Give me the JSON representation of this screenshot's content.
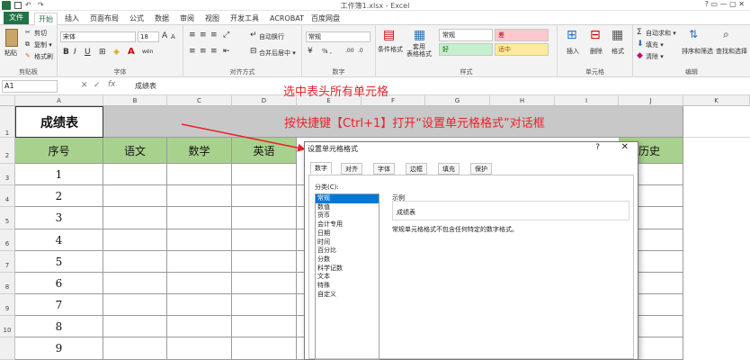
{
  "window": {
    "title": "工作簿1.xlsx - Excel",
    "controls": "?  ▭  —  ▢  ✕"
  },
  "tabs": [
    "文件",
    "开始",
    "插入",
    "页面布局",
    "公式",
    "数据",
    "审阅",
    "视图",
    "开发工具",
    "ACROBAT",
    "百度网盘"
  ],
  "ribbon": {
    "clipboard": {
      "paste": "粘贴",
      "cut": "剪切",
      "copy": "复制 ▾",
      "painter": "格式刷",
      "label": "剪贴板"
    },
    "font": {
      "name": "宋体",
      "size": "18",
      "grow": "A",
      "shrink": "A",
      "bold": "B",
      "italic": "I",
      "underline": "U",
      "wen": "wén",
      "label": "字体"
    },
    "alignment": {
      "wrap": "自动换行",
      "merge": "合并后居中 ▾",
      "label": "对齐方式"
    },
    "number": {
      "format": "常规",
      "currency": "% ,",
      "label": "数字"
    },
    "styles": {
      "cond": "条件格式",
      "table": "套用\n表格格式",
      "normal": "常规",
      "bad": "差",
      "good": "好",
      "neutral": "适中",
      "label": "样式"
    },
    "cells": {
      "insert": "插入",
      "delete": "删除",
      "format": "格式",
      "label": "单元格"
    },
    "editing": {
      "autosum": "自动求和 ▾",
      "fill": "填充 ▾",
      "clear": "清除 ▾",
      "sort": "排序和筛选",
      "find": "查找和选择",
      "label": "编辑"
    }
  },
  "formula_bar": {
    "name_box": "A1",
    "fx": "fx",
    "content": "成绩表"
  },
  "columns": [
    "A",
    "B",
    "C",
    "D",
    "E",
    "F",
    "G",
    "H",
    "I",
    "J",
    "K"
  ],
  "rows": [
    "1",
    "2",
    "3",
    "4",
    "5",
    "6",
    "7",
    "8",
    "9",
    "10"
  ],
  "sheet": {
    "title": "成绩表",
    "headers": [
      "序号",
      "语文",
      "数学",
      "英语",
      "历史"
    ],
    "serials": [
      "1",
      "2",
      "3",
      "4",
      "5",
      "6",
      "7",
      "8",
      "9"
    ]
  },
  "annotations": {
    "line1": "选中表头所有单元格",
    "line2": "按快捷键【Ctrl+1】打开“设置单元格格式”对话框"
  },
  "dialog": {
    "title": "设置单元格格式",
    "help": "?",
    "close": "✕",
    "tabs": [
      "数字",
      "对齐",
      "字体",
      "边框",
      "填充",
      "保护"
    ],
    "category_label": "分类(C):",
    "categories": [
      "常规",
      "数值",
      "货币",
      "会计专用",
      "日期",
      "时间",
      "百分比",
      "分数",
      "科学记数",
      "文本",
      "特殊",
      "自定义"
    ],
    "sample_label": "示例",
    "sample_value": "成绩表",
    "description": "常规单元格格式不包含任何特定的数字格式。"
  },
  "colors": {
    "accent": "#217346",
    "header_fill": "#a9d18e",
    "annotation": "#e8232b",
    "selection": "#0078d7"
  }
}
